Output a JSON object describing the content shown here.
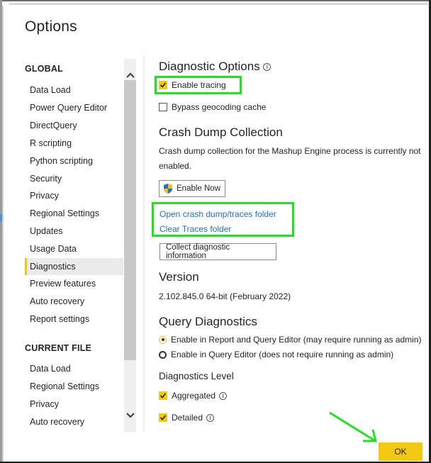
{
  "dialog": {
    "title": "Options"
  },
  "sidebar": {
    "global_label": "GLOBAL",
    "global_items": [
      {
        "label": "Data Load",
        "active": false
      },
      {
        "label": "Power Query Editor",
        "active": false
      },
      {
        "label": "DirectQuery",
        "active": false
      },
      {
        "label": "R scripting",
        "active": false
      },
      {
        "label": "Python scripting",
        "active": false
      },
      {
        "label": "Security",
        "active": false
      },
      {
        "label": "Privacy",
        "active": false
      },
      {
        "label": "Regional Settings",
        "active": false
      },
      {
        "label": "Updates",
        "active": false
      },
      {
        "label": "Usage Data",
        "active": false
      },
      {
        "label": "Diagnostics",
        "active": true
      },
      {
        "label": "Preview features",
        "active": false
      },
      {
        "label": "Auto recovery",
        "active": false
      },
      {
        "label": "Report settings",
        "active": false
      }
    ],
    "current_file_label": "CURRENT FILE",
    "current_file_items": [
      {
        "label": "Data Load"
      },
      {
        "label": "Regional Settings"
      },
      {
        "label": "Privacy"
      },
      {
        "label": "Auto recovery"
      }
    ],
    "scroll_up_icon": "chevron-up-icon",
    "scroll_down_icon": "chevron-down-icon"
  },
  "diagnostic_options": {
    "heading": "Diagnostic Options",
    "info_icon": "info-icon",
    "enable_tracing": {
      "label": "Enable tracing",
      "checked": true
    },
    "bypass_geocoding": {
      "label": "Bypass geocoding cache",
      "checked": false
    }
  },
  "crash_dump": {
    "heading": "Crash Dump Collection",
    "description_line1": "Crash dump collection for the Mashup Engine process is currently not",
    "description_line2": "enabled.",
    "enable_now_label": "Enable Now",
    "enable_now_icon": "uac-shield-icon",
    "open_folder_link": "Open crash dump/traces folder",
    "clear_traces_link": "Clear Traces folder",
    "collect_button": "Collect diagnostic information"
  },
  "version": {
    "heading": "Version",
    "value": "2.102.845.0 64-bit (February 2022)"
  },
  "query_diagnostics": {
    "heading": "Query Diagnostics",
    "options": [
      {
        "label": "Enable in Report and Query Editor (may require running as admin)",
        "selected": true
      },
      {
        "label": "Enable in Query Editor (does not require running as admin)",
        "selected": false
      }
    ],
    "level_heading": "Diagnostics Level",
    "aggregated": {
      "label": "Aggregated",
      "checked": true
    },
    "detailed": {
      "label": "Detailed",
      "checked": true
    }
  },
  "footer": {
    "ok_label": "OK"
  },
  "annotations": {
    "highlight_color": "#22e022",
    "accent_color": "#f2c811",
    "link_color": "#1f6fc5"
  }
}
